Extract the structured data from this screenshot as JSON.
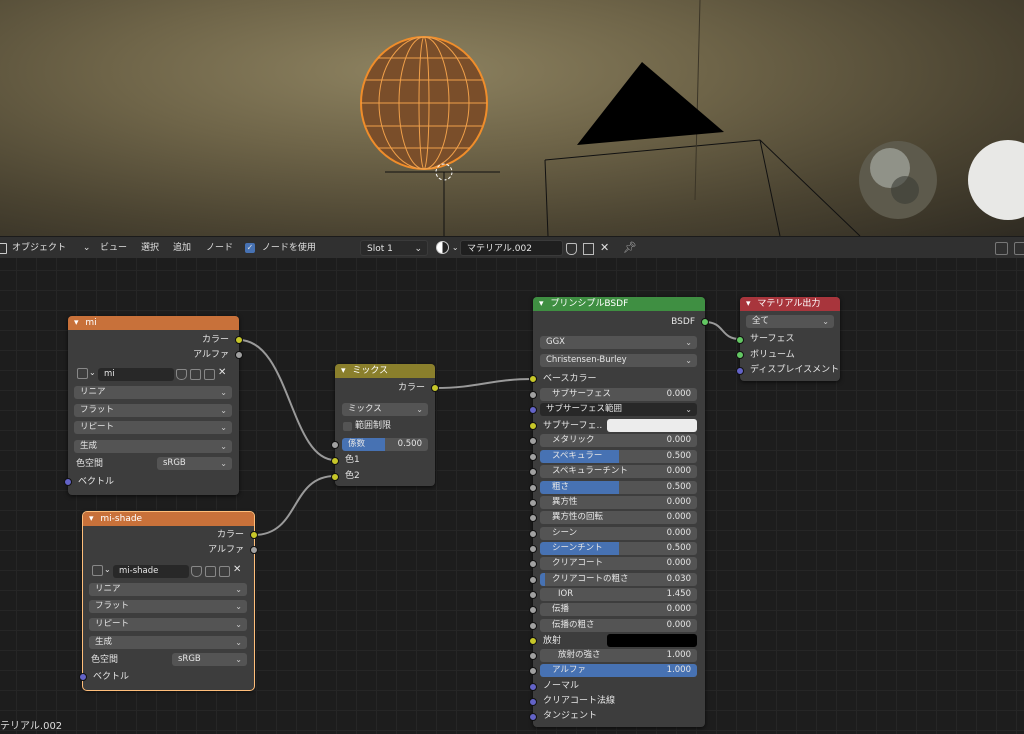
{
  "header": {
    "editor_type": "オブジェクト",
    "menu_view": "ビュー",
    "menu_select": "選択",
    "menu_add": "追加",
    "menu_node": "ノード",
    "use_nodes_label": "ノードを使用",
    "use_nodes_checked": true,
    "slot": "Slot 1",
    "material_name": "マテリアル.002"
  },
  "nodes": {
    "mi": {
      "title": "mi",
      "out_color": "カラー",
      "out_alpha": "アルファ",
      "image": "mi",
      "interp": "リニア",
      "projection": "フラット",
      "extension": "リピート",
      "source": "生成",
      "colorspace_label": "色空間",
      "colorspace": "sRGB",
      "in_vector": "ベクトル"
    },
    "mishade": {
      "title": "mi-shade",
      "out_color": "カラー",
      "out_alpha": "アルファ",
      "image": "mi-shade",
      "interp": "リニア",
      "projection": "フラット",
      "extension": "リピート",
      "source": "生成",
      "colorspace_label": "色空間",
      "colorspace": "sRGB",
      "in_vector": "ベクトル"
    },
    "mix": {
      "title": "ミックス",
      "out_color": "カラー",
      "blend": "ミックス",
      "clamp": "範囲制限",
      "fac_label": "係数",
      "fac_value": "0.500",
      "fac_fraction": 0.5,
      "in_color1": "色1",
      "in_color2": "色2"
    },
    "bsdf": {
      "title": "プリンシプルBSDF",
      "out": "BSDF",
      "distribution": "GGX",
      "subsurface_method": "Christensen-Burley",
      "base_color": "ベースカラー",
      "subsurface": {
        "label": "サブサーフェス",
        "value": "0.000"
      },
      "subsurface_radius": "サブサーフェス範囲",
      "subsurface_color": "サブサーフェ...",
      "metallic": {
        "label": "メタリック",
        "value": "0.000"
      },
      "specular": {
        "label": "スペキュラー",
        "value": "0.500",
        "fraction": 0.5
      },
      "specular_tint": {
        "label": "スペキュラーチント",
        "value": "0.000"
      },
      "roughness": {
        "label": "粗さ",
        "value": "0.500",
        "fraction": 0.5
      },
      "anisotropic": {
        "label": "異方性",
        "value": "0.000"
      },
      "anisotropic_rotation": {
        "label": "異方性の回転",
        "value": "0.000"
      },
      "sheen": {
        "label": "シーン",
        "value": "0.000"
      },
      "sheen_tint": {
        "label": "シーンチント",
        "value": "0.500",
        "fraction": 0.5
      },
      "clearcoat": {
        "label": "クリアコート",
        "value": "0.000"
      },
      "clearcoat_roughness": {
        "label": "クリアコートの粗さ",
        "value": "0.030",
        "fraction": 0.03
      },
      "ior": {
        "label": "IOR",
        "value": "1.450"
      },
      "transmission": {
        "label": "伝播",
        "value": "0.000"
      },
      "transmission_roughness": {
        "label": "伝播の粗さ",
        "value": "0.000"
      },
      "emission": "放射",
      "emission_strength": {
        "label": "放射の強さ",
        "value": "1.000"
      },
      "alpha": {
        "label": "アルファ",
        "value": "1.000",
        "fraction": 1.0
      },
      "normal": "ノーマル",
      "clearcoat_normal": "クリアコート法線",
      "tangent": "タンジェント"
    },
    "output": {
      "title": "マテリアル出力",
      "target": "全て",
      "surface": "サーフェス",
      "volume": "ボリューム",
      "displacement": "ディスプレイスメント"
    }
  },
  "colors": {
    "texture_header": "#c8713a",
    "mix_header": "#8a7f2c",
    "shader_header": "#3f8f42",
    "output_header": "#a8353c",
    "accent": "#4772b3"
  },
  "status_text": "テリアル.002"
}
